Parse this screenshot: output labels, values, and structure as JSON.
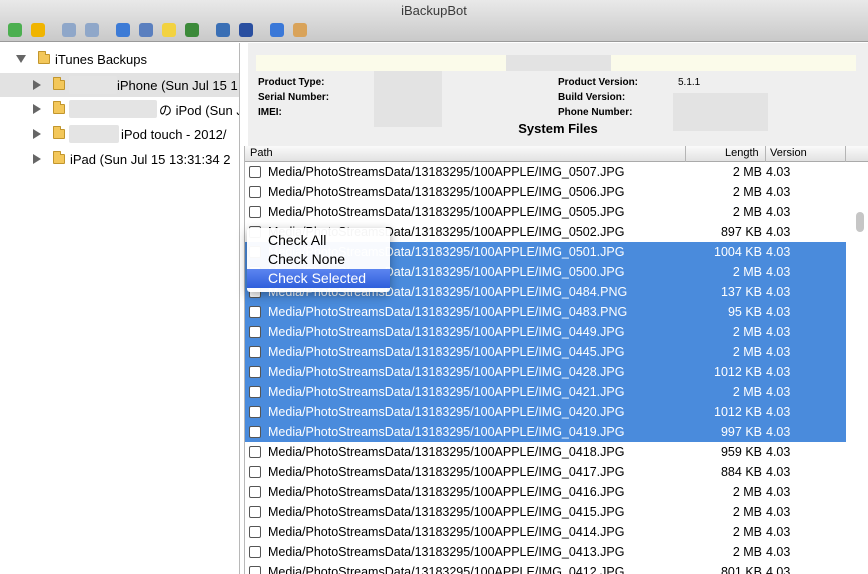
{
  "window": {
    "title": "iBackupBot"
  },
  "toolbar": {
    "icons": [
      {
        "name": "refresh-icon",
        "color": "#4caf50"
      },
      {
        "name": "export-icon",
        "color": "#f0b400"
      },
      {
        "name": "new-file-icon",
        "color": "#8fa7c9"
      },
      {
        "name": "copy-file-icon",
        "color": "#8fa7c9"
      },
      {
        "name": "messages-icon",
        "color": "#3d7bd6"
      },
      {
        "name": "contacts-icon",
        "color": "#5a7fbf"
      },
      {
        "name": "notes-icon",
        "color": "#f2d240"
      },
      {
        "name": "safari-icon",
        "color": "#3c8a3a"
      },
      {
        "name": "film-icon",
        "color": "#3a6fb5"
      },
      {
        "name": "transfer-icon",
        "color": "#2a4fa0"
      },
      {
        "name": "help-icon",
        "color": "#3a78d8"
      },
      {
        "name": "register-icon",
        "color": "#d9a35a"
      }
    ]
  },
  "tree": {
    "root_label": "iTunes Backups",
    "items": [
      {
        "label": "iPhone (Sun Jul 15 1"
      },
      {
        "label": "の iPod (Sun J"
      },
      {
        "label": "iPod touch - 2012/"
      },
      {
        "label": "iPad (Sun Jul 15 13:31:34 2"
      }
    ]
  },
  "info": {
    "product_type_label": "Product Type:",
    "serial_number_label": "Serial Number:",
    "imei_label": "IMEI:",
    "product_version_label": "Product Version:",
    "product_version_value": "5.1.1",
    "build_version_label": "Build Version:",
    "phone_number_label": "Phone Number:",
    "section_title": "System Files"
  },
  "list": {
    "columns": {
      "path": "Path",
      "length": "Length",
      "version": "Version"
    },
    "rows": [
      {
        "path": "Media/PhotoStreamsData/13183295/100APPLE/IMG_0507.JPG",
        "length": "2 MB",
        "version": "4.03",
        "selected": false
      },
      {
        "path": "Media/PhotoStreamsData/13183295/100APPLE/IMG_0506.JPG",
        "length": "2 MB",
        "version": "4.03",
        "selected": false
      },
      {
        "path": "Media/PhotoStreamsData/13183295/100APPLE/IMG_0505.JPG",
        "length": "2 MB",
        "version": "4.03",
        "selected": false
      },
      {
        "path": "Media/PhotoStreamsData/13183295/100APPLE/IMG_0502.JPG",
        "length": "897 KB",
        "version": "4.03",
        "selected": false
      },
      {
        "path": "Media/PhotoStreamsData/13183295/100APPLE/IMG_0501.JPG",
        "length": "1004 KB",
        "version": "4.03",
        "selected": true
      },
      {
        "path": "Media/PhotoStreamsData/13183295/100APPLE/IMG_0500.JPG",
        "length": "2 MB",
        "version": "4.03",
        "selected": true
      },
      {
        "path": "Media/PhotoStreamsData/13183295/100APPLE/IMG_0484.PNG",
        "length": "137 KB",
        "version": "4.03",
        "selected": true
      },
      {
        "path": "Media/PhotoStreamsData/13183295/100APPLE/IMG_0483.PNG",
        "length": "95 KB",
        "version": "4.03",
        "selected": true
      },
      {
        "path": "Media/PhotoStreamsData/13183295/100APPLE/IMG_0449.JPG",
        "length": "2 MB",
        "version": "4.03",
        "selected": true
      },
      {
        "path": "Media/PhotoStreamsData/13183295/100APPLE/IMG_0445.JPG",
        "length": "2 MB",
        "version": "4.03",
        "selected": true
      },
      {
        "path": "Media/PhotoStreamsData/13183295/100APPLE/IMG_0428.JPG",
        "length": "1012 KB",
        "version": "4.03",
        "selected": true
      },
      {
        "path": "Media/PhotoStreamsData/13183295/100APPLE/IMG_0421.JPG",
        "length": "2 MB",
        "version": "4.03",
        "selected": true
      },
      {
        "path": "Media/PhotoStreamsData/13183295/100APPLE/IMG_0420.JPG",
        "length": "1012 KB",
        "version": "4.03",
        "selected": true
      },
      {
        "path": "Media/PhotoStreamsData/13183295/100APPLE/IMG_0419.JPG",
        "length": "997 KB",
        "version": "4.03",
        "selected": true
      },
      {
        "path": "Media/PhotoStreamsData/13183295/100APPLE/IMG_0418.JPG",
        "length": "959 KB",
        "version": "4.03",
        "selected": false
      },
      {
        "path": "Media/PhotoStreamsData/13183295/100APPLE/IMG_0417.JPG",
        "length": "884 KB",
        "version": "4.03",
        "selected": false
      },
      {
        "path": "Media/PhotoStreamsData/13183295/100APPLE/IMG_0416.JPG",
        "length": "2 MB",
        "version": "4.03",
        "selected": false
      },
      {
        "path": "Media/PhotoStreamsData/13183295/100APPLE/IMG_0415.JPG",
        "length": "2 MB",
        "version": "4.03",
        "selected": false
      },
      {
        "path": "Media/PhotoStreamsData/13183295/100APPLE/IMG_0414.JPG",
        "length": "2 MB",
        "version": "4.03",
        "selected": false
      },
      {
        "path": "Media/PhotoStreamsData/13183295/100APPLE/IMG_0413.JPG",
        "length": "2 MB",
        "version": "4.03",
        "selected": false
      },
      {
        "path": "Media/PhotoStreamsData/13183295/100APPLE/IMG_0412.JPG",
        "length": "801 KB",
        "version": "4.03",
        "selected": false
      }
    ]
  },
  "context_menu": {
    "items": [
      {
        "label": "Check All",
        "active": false
      },
      {
        "label": "Check None",
        "active": false
      },
      {
        "label": "Check Selected",
        "active": true
      }
    ]
  }
}
